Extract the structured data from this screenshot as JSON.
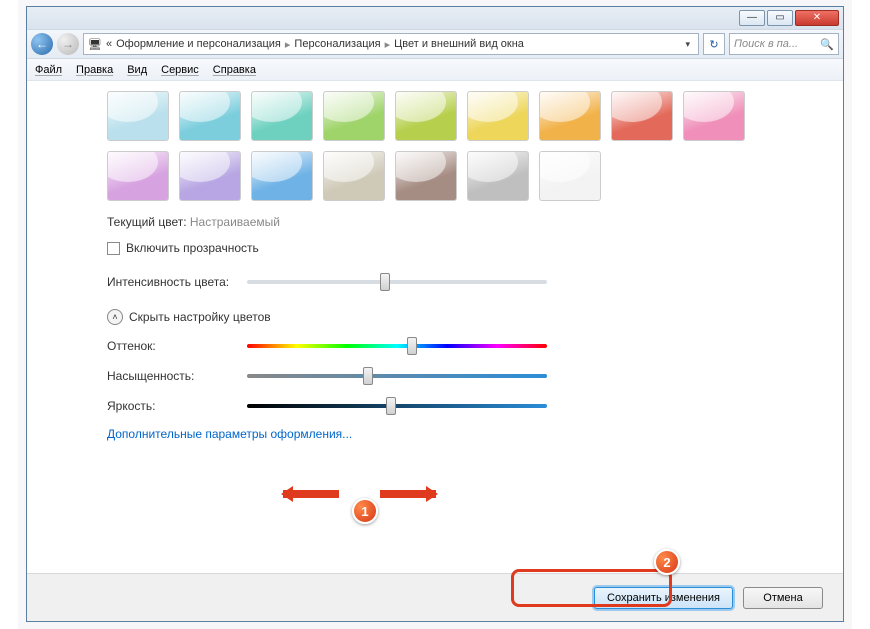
{
  "titlebar": {
    "min": "—",
    "max": "▭",
    "close": "✕"
  },
  "nav": {
    "back": "←",
    "fwd": "→"
  },
  "breadcrumb": {
    "prefix": "«",
    "c1": "Оформление и персонализация",
    "c2": "Персонализация",
    "c3": "Цвет и внешний вид окна",
    "sep": "▸",
    "drop": "▾"
  },
  "search": {
    "placeholder": "Поиск в па...",
    "icon": "🔍"
  },
  "refresh": "↻",
  "menu": {
    "file": "Файл",
    "edit": "Правка",
    "view": "Вид",
    "tools": "Сервис",
    "help": "Справка"
  },
  "swatches_row1": [
    "#b9e0ec",
    "#7ccedd",
    "#6ed1c0",
    "#9fd46a",
    "#b6cf4c",
    "#edd65a",
    "#f2b24a",
    "#e36a5a"
  ],
  "swatches_row2": [
    "#f08fb9",
    "#d7a2e0",
    "#b7a6e3",
    "#6fb2e6",
    "#cfc9b8",
    "#a68d83",
    "#bfbfbf",
    "#f3f3f3"
  ],
  "labels": {
    "current": "Текущий цвет:",
    "current_val": "Настраиваемый",
    "transparency": "Включить прозрачность",
    "intensity": "Интенсивность цвета:",
    "hide": "Скрыть настройку цветов",
    "hue": "Оттенок:",
    "sat": "Насыщенность:",
    "bri": "Яркость:",
    "advanced": "Дополнительные параметры оформления..."
  },
  "sliders": {
    "intensity": 46,
    "hue": 55,
    "sat": 40,
    "bri": 48
  },
  "buttons": {
    "save": "Сохранить изменения",
    "cancel": "Отмена"
  },
  "markers": {
    "m1": "1",
    "m2": "2"
  }
}
